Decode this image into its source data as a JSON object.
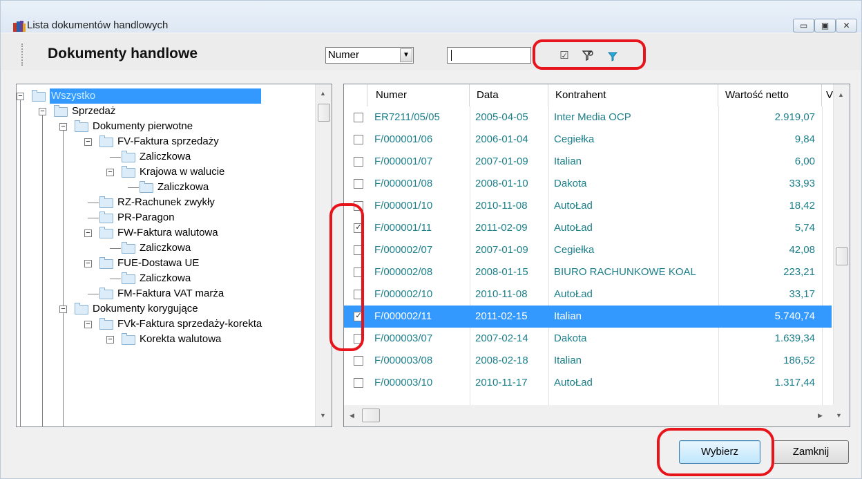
{
  "window": {
    "title": "Lista dokumentów handlowych",
    "minimize": "▭",
    "maximize": "▣",
    "close": "✕"
  },
  "toolbar": {
    "title": "Dokumenty handlowe",
    "search_field_value": "Numer",
    "search_text": ""
  },
  "tree": {
    "items": [
      {
        "label": "Wszystko",
        "selected": true
      },
      {
        "label": "Sprzedaż"
      },
      {
        "label": "Dokumenty pierwotne"
      },
      {
        "label": "FV-Faktura sprzedaży"
      },
      {
        "label": "Zaliczkowa"
      },
      {
        "label": "Krajowa w walucie"
      },
      {
        "label": "Zaliczkowa"
      },
      {
        "label": "RZ-Rachunek zwykły"
      },
      {
        "label": "PR-Paragon"
      },
      {
        "label": "FW-Faktura walutowa"
      },
      {
        "label": "Zaliczkowa"
      },
      {
        "label": "FUE-Dostawa UE"
      },
      {
        "label": "Zaliczkowa"
      },
      {
        "label": "FM-Faktura VAT marża"
      },
      {
        "label": "Dokumenty korygujące"
      },
      {
        "label": "FVk-Faktura sprzedaży-korekta"
      },
      {
        "label": "Korekta walutowa"
      }
    ]
  },
  "grid": {
    "columns": [
      "Numer",
      "Data",
      "Kontrahent",
      "Wartość netto",
      "V"
    ],
    "rows": [
      {
        "checked": false,
        "numer": "ER7211/05/05",
        "data": "2005-04-05",
        "kontrahent": "Inter Media OCP",
        "netto": "2.919,07"
      },
      {
        "checked": false,
        "numer": "F/000001/06",
        "data": "2006-01-04",
        "kontrahent": "Cegiełka",
        "netto": "9,84"
      },
      {
        "checked": false,
        "numer": "F/000001/07",
        "data": "2007-01-09",
        "kontrahent": "Italian",
        "netto": "6,00"
      },
      {
        "checked": false,
        "numer": "F/000001/08",
        "data": "2008-01-10",
        "kontrahent": "Dakota",
        "netto": "33,93"
      },
      {
        "checked": false,
        "numer": "F/000001/10",
        "data": "2010-11-08",
        "kontrahent": "AutoŁad",
        "netto": "18,42"
      },
      {
        "checked": true,
        "numer": "F/000001/11",
        "data": "2011-02-09",
        "kontrahent": "AutoŁad",
        "netto": "5,74"
      },
      {
        "checked": false,
        "numer": "F/000002/07",
        "data": "2007-01-09",
        "kontrahent": "Cegiełka",
        "netto": "42,08"
      },
      {
        "checked": false,
        "numer": "F/000002/08",
        "data": "2008-01-15",
        "kontrahent": "BIURO RACHUNKOWE KOAL",
        "netto": "223,21"
      },
      {
        "checked": false,
        "numer": "F/000002/10",
        "data": "2010-11-08",
        "kontrahent": "AutoŁad",
        "netto": "33,17"
      },
      {
        "checked": true,
        "numer": "F/000002/11",
        "data": "2011-02-15",
        "kontrahent": "Italian",
        "netto": "5.740,74",
        "selected": true
      },
      {
        "checked": false,
        "numer": "F/000003/07",
        "data": "2007-02-14",
        "kontrahent": "Dakota",
        "netto": "1.639,34"
      },
      {
        "checked": false,
        "numer": "F/000003/08",
        "data": "2008-02-18",
        "kontrahent": "Italian",
        "netto": "186,52"
      },
      {
        "checked": false,
        "numer": "F/000003/10",
        "data": "2010-11-17",
        "kontrahent": "AutoŁad",
        "netto": "1.317,44"
      }
    ]
  },
  "buttons": {
    "select": "Wybierz",
    "close": "Zamknij"
  },
  "colors": {
    "highlight": "#e8141b",
    "selection": "#3399ff",
    "link_text": "#1c7f89"
  },
  "icons": [
    "app-icon",
    "checkbox-filter-icon",
    "filter-edit-icon",
    "filter-icon"
  ]
}
